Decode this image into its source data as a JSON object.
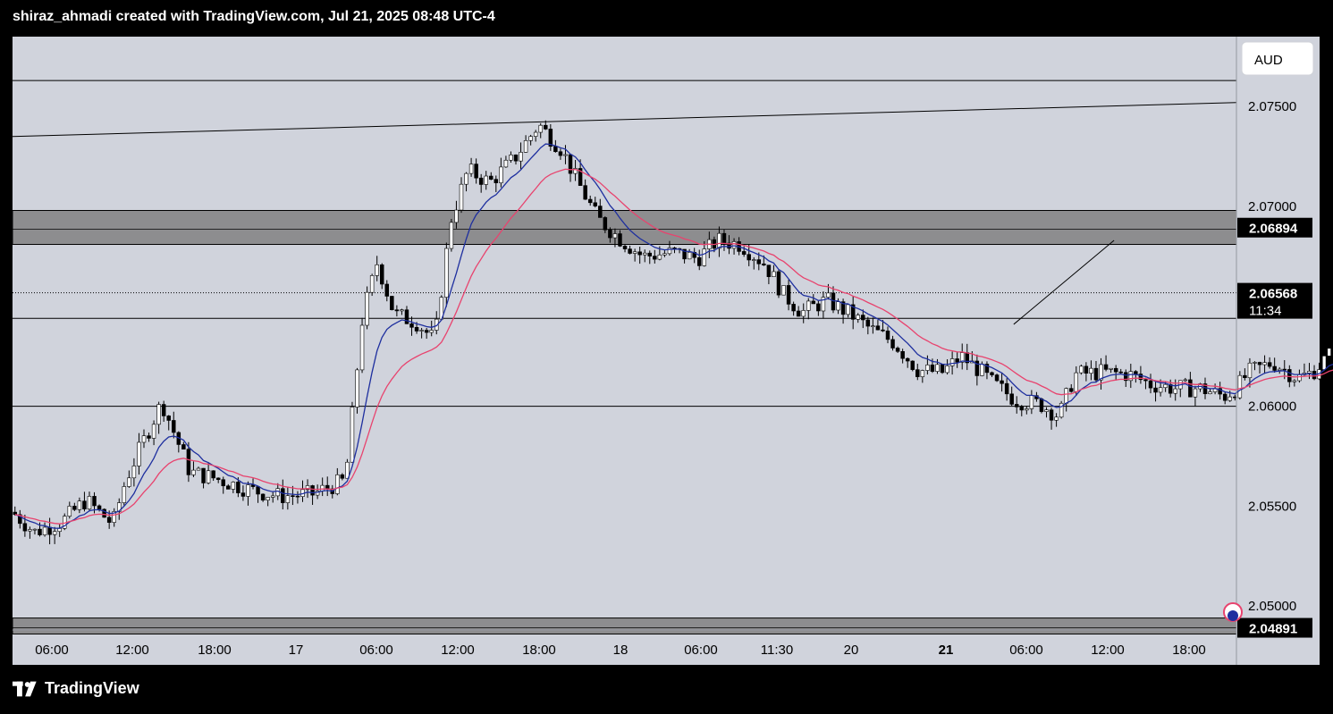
{
  "header": {
    "attribution": "shiraz_ahmadi created with TradingView.com, Jul 21, 2025 08:48 UTC-4"
  },
  "footer": {
    "brand": "TradingView"
  },
  "currency_button": "AUD",
  "colors": {
    "background": "#d0d3dc",
    "ema_fast": "#1e2f9f",
    "ema_slow": "#e8436e",
    "zone": "#8d8d8f",
    "candle": "#000000"
  },
  "chart_data": {
    "type": "candlestick",
    "currency": "AUD",
    "ylim": [
      2.0488,
      2.0785
    ],
    "y_ticks": [
      {
        "value": 2.075,
        "label": "2.07500"
      },
      {
        "value": 2.07,
        "label": "2.07000"
      },
      {
        "value": 2.06,
        "label": "2.06000"
      },
      {
        "value": 2.055,
        "label": "2.05500"
      },
      {
        "value": 2.05,
        "label": "2.05000"
      }
    ],
    "x_ticks": [
      {
        "label": "06:00",
        "bold": false
      },
      {
        "label": "12:00",
        "bold": false
      },
      {
        "label": "18:00",
        "bold": false
      },
      {
        "label": "17",
        "bold": false
      },
      {
        "label": "06:00",
        "bold": false
      },
      {
        "label": "12:00",
        "bold": false
      },
      {
        "label": "18:00",
        "bold": false
      },
      {
        "label": "18",
        "bold": false
      },
      {
        "label": "06:00",
        "bold": false
      },
      {
        "label": "11:30",
        "bold": false
      },
      {
        "label": "20",
        "bold": false
      },
      {
        "label": "21",
        "bold": true
      },
      {
        "label": "06:00",
        "bold": false
      },
      {
        "label": "12:00",
        "bold": false
      },
      {
        "label": "18:00",
        "bold": false
      }
    ],
    "price_labels": [
      {
        "value": 2.06894,
        "label": "2.06894",
        "style": "dark"
      },
      {
        "value": 2.06568,
        "label": "2.06568",
        "sub": "11:34",
        "style": "dark"
      },
      {
        "value": 2.04891,
        "label": "2.04891",
        "style": "dark"
      }
    ],
    "zones": [
      {
        "from": 2.0681,
        "to": 2.0698
      },
      {
        "from": 2.0486,
        "to": 2.0494
      }
    ],
    "horizontal_lines": [
      2.0763,
      2.0644,
      2.06
    ],
    "current_price_line": 2.06568,
    "trendlines": [
      {
        "from": [
          0,
          2.0735
        ],
        "to": [
          1,
          2.0752
        ]
      },
      {
        "from": [
          0.818,
          2.0641
        ],
        "to": [
          0.9,
          2.0683
        ]
      }
    ],
    "anchors": [
      [
        0,
        2.0547
      ],
      [
        0.018,
        2.0537
      ],
      [
        0.04,
        2.0542
      ],
      [
        0.06,
        2.0553
      ],
      [
        0.082,
        2.0541
      ],
      [
        0.092,
        2.0562
      ],
      [
        0.102,
        2.0576
      ],
      [
        0.122,
        2.0602
      ],
      [
        0.145,
        2.0567
      ],
      [
        0.165,
        2.0564
      ],
      [
        0.195,
        2.0558
      ],
      [
        0.218,
        2.0555
      ],
      [
        0.245,
        2.0556
      ],
      [
        0.272,
        2.0563
      ],
      [
        0.286,
        2.0645
      ],
      [
        0.298,
        2.0672
      ],
      [
        0.312,
        2.0646
      ],
      [
        0.33,
        2.0642
      ],
      [
        0.345,
        2.0633
      ],
      [
        0.358,
        2.0693
      ],
      [
        0.372,
        2.0718
      ],
      [
        0.39,
        2.0712
      ],
      [
        0.41,
        2.0724
      ],
      [
        0.43,
        2.0741
      ],
      [
        0.448,
        2.0729
      ],
      [
        0.462,
        2.0712
      ],
      [
        0.478,
        2.0694
      ],
      [
        0.496,
        2.0684
      ],
      [
        0.515,
        2.0675
      ],
      [
        0.54,
        2.0677
      ],
      [
        0.56,
        2.0674
      ],
      [
        0.576,
        2.0683
      ],
      [
        0.595,
        2.0681
      ],
      [
        0.615,
        2.0671
      ],
      [
        0.63,
        2.0656
      ],
      [
        0.645,
        2.0647
      ],
      [
        0.665,
        2.0653
      ],
      [
        0.685,
        2.0646
      ],
      [
        0.7,
        2.0639
      ],
      [
        0.72,
        2.0632
      ],
      [
        0.74,
        2.0618
      ],
      [
        0.76,
        2.0617
      ],
      [
        0.775,
        2.0625
      ],
      [
        0.79,
        2.0618
      ],
      [
        0.8,
        2.0612
      ],
      [
        0.82,
        2.0603
      ],
      [
        0.84,
        2.0601
      ],
      [
        0.855,
        2.0595
      ],
      [
        0.868,
        2.0616
      ],
      [
        0.89,
        2.0617
      ],
      [
        0.912,
        2.0616
      ],
      [
        0.93,
        2.0611
      ],
      [
        0.95,
        2.0609
      ],
      [
        0.97,
        2.0609
      ],
      [
        0.99,
        2.0605
      ],
      [
        1.0,
        2.0609
      ],
      [
        1.01,
        2.0617
      ],
      [
        1.03,
        2.0622
      ],
      [
        1.05,
        2.0614
      ],
      [
        1.062,
        2.0617
      ],
      [
        1.078,
        2.0627
      ],
      [
        1.098,
        2.0645
      ],
      [
        1.115,
        2.0658
      ],
      [
        1.135,
        2.0653
      ],
      [
        1.15,
        2.0664
      ],
      [
        1.165,
        2.066
      ],
      [
        1.175,
        2.0657
      ]
    ]
  }
}
